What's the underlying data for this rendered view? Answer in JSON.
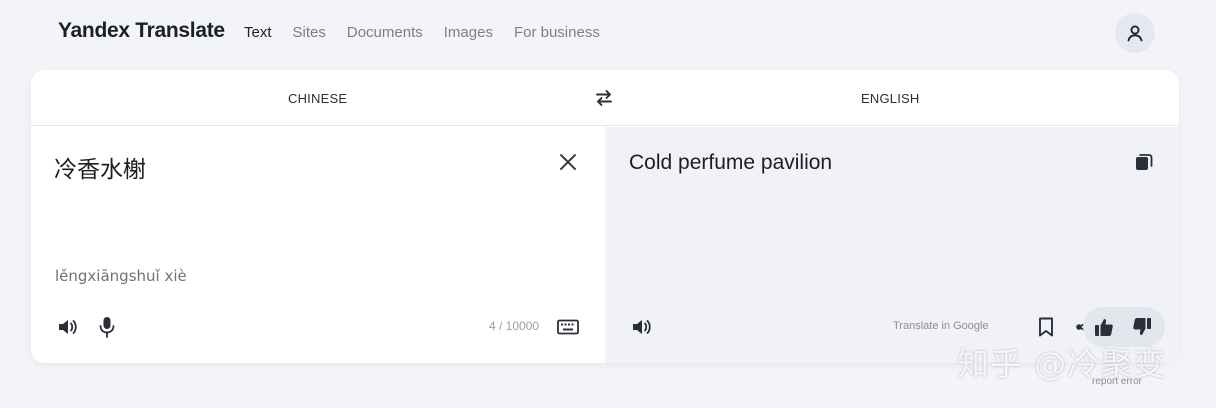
{
  "header": {
    "logo": "Yandex Translate",
    "nav": [
      {
        "label": "Text",
        "active": true
      },
      {
        "label": "Sites",
        "active": false
      },
      {
        "label": "Documents",
        "active": false
      },
      {
        "label": "Images",
        "active": false
      },
      {
        "label": "For business",
        "active": false
      }
    ],
    "avatar_icon": "user-icon"
  },
  "languages": {
    "source": "CHINESE",
    "target": "ENGLISH",
    "swap_icon": "swap-arrows-icon"
  },
  "source": {
    "text": "冷香水榭",
    "transliteration": "lěngxiāngshuǐ xiè",
    "counter": "4 / 10000",
    "icons": [
      "speaker-icon",
      "microphone-icon",
      "keyboard-icon",
      "close-icon"
    ]
  },
  "target": {
    "text": "Cold perfume pavilion",
    "translate_in_google": "Translate in Google",
    "report_error": "report error",
    "icons": [
      "copy-icon",
      "speaker-icon",
      "bookmark-icon",
      "share-icon",
      "thumbs-up-icon",
      "thumbs-down-icon"
    ]
  },
  "watermark": "知乎 @冷聚变",
  "colors": {
    "background": "#f3f4f8",
    "card": "#ffffff",
    "target_pane": "#f1f2f7",
    "text": "#1e1e1e",
    "muted": "#7b7f8a"
  }
}
